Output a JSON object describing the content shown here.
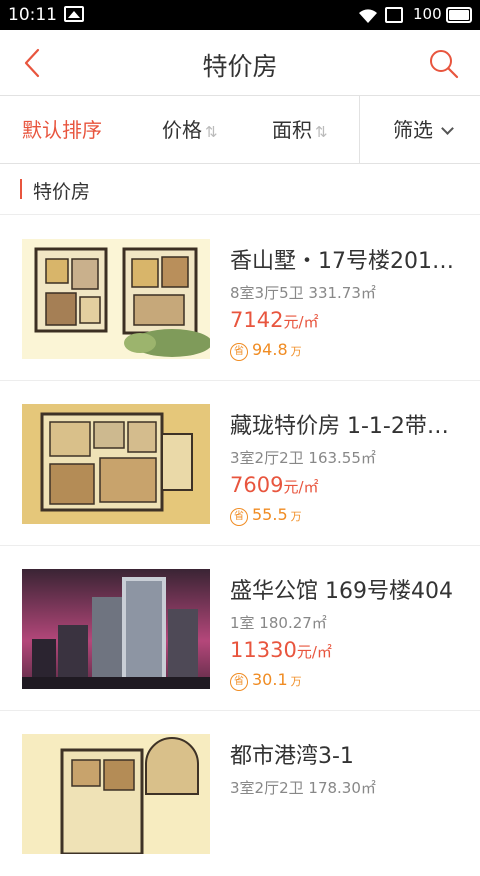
{
  "status_bar": {
    "time": "10:11",
    "battery": "100"
  },
  "header": {
    "title": "特价房"
  },
  "sort_bar": {
    "default_label": "默认排序",
    "price_label": "价格",
    "area_label": "面积",
    "filter_label": "筛选",
    "sort_arrows": "⇅"
  },
  "section": {
    "title": "特价房"
  },
  "listings": [
    {
      "name": "香山墅・17号楼201…",
      "specs": "8室3厅5卫 331.73㎡",
      "price": "7142",
      "price_unit": "元/㎡",
      "saving_badge": "省",
      "saving": "94.8",
      "saving_unit": "万"
    },
    {
      "name": "藏珑特价房 1-1-2带…",
      "specs": "3室2厅2卫 163.55㎡",
      "price": "7609",
      "price_unit": "元/㎡",
      "saving_badge": "省",
      "saving": "55.5",
      "saving_unit": "万"
    },
    {
      "name": "盛华公馆 169号楼404",
      "specs": "1室 180.27㎡",
      "price": "11330",
      "price_unit": "元/㎡",
      "saving_badge": "省",
      "saving": "30.1",
      "saving_unit": "万"
    },
    {
      "name": "都市港湾3-1",
      "specs": "3室2厅2卫 178.30㎡",
      "price": "",
      "price_unit": "",
      "saving_badge": "",
      "saving": "",
      "saving_unit": ""
    }
  ],
  "colors": {
    "accent": "#e8553e",
    "saving": "#f08c23",
    "text": "#333333",
    "muted": "#888888"
  }
}
